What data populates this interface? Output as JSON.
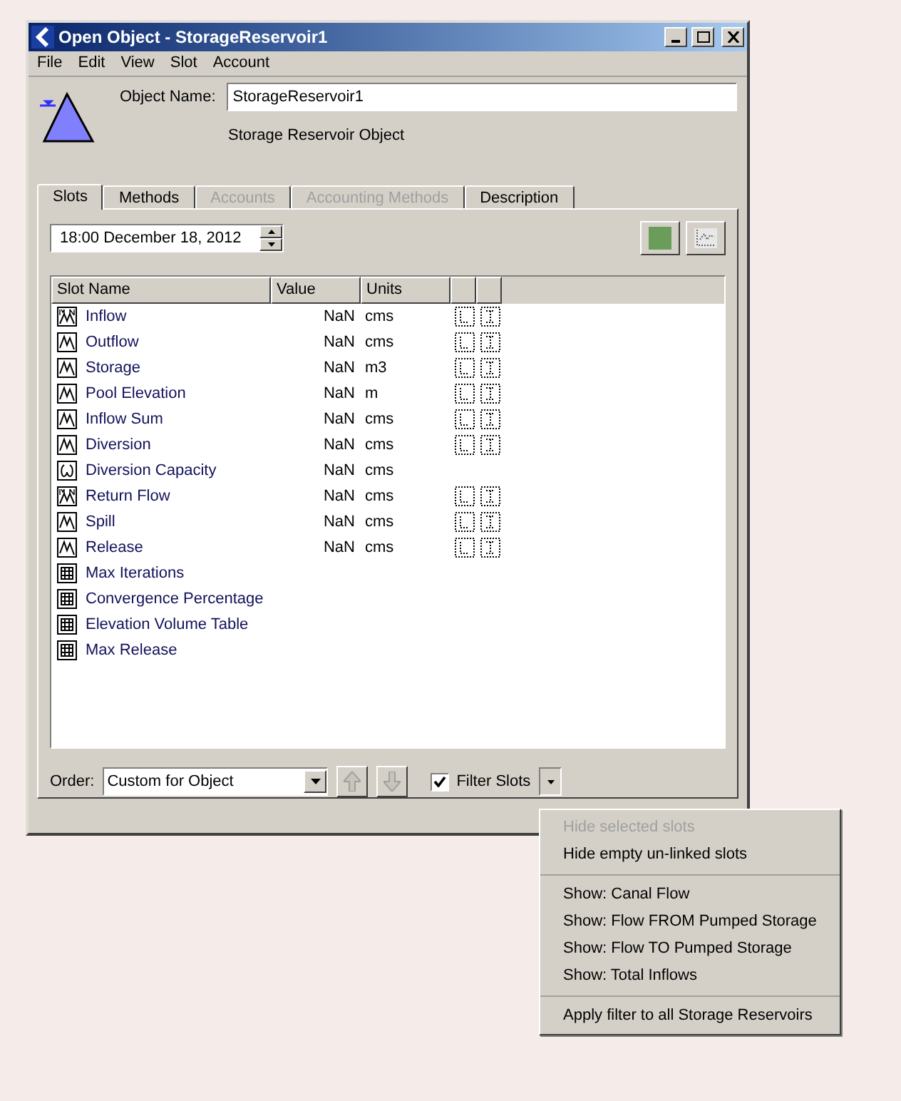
{
  "window": {
    "title": "Open Object - StorageReservoir1"
  },
  "menu_bar": [
    "File",
    "Edit",
    "View",
    "Slot",
    "Account"
  ],
  "object_name": {
    "label": "Object Name:",
    "value": "StorageReservoir1"
  },
  "object_type": "Storage Reservoir Object",
  "tabs": [
    {
      "label": "Slots",
      "selected": true,
      "disabled": false
    },
    {
      "label": "Methods",
      "selected": false,
      "disabled": false
    },
    {
      "label": "Accounts",
      "selected": false,
      "disabled": true
    },
    {
      "label": "Accounting Methods",
      "selected": false,
      "disabled": true
    },
    {
      "label": "Description",
      "selected": false,
      "disabled": false
    }
  ],
  "timestep": "18:00 December 18, 2012",
  "table": {
    "columns": [
      "Slot Name",
      "Value",
      "Units"
    ],
    "rows": [
      {
        "kind": "multi_series",
        "name": "Inflow",
        "value": "NaN",
        "units": "cms",
        "flags": true
      },
      {
        "kind": "series",
        "name": "Outflow",
        "value": "NaN",
        "units": "cms",
        "flags": true
      },
      {
        "kind": "series",
        "name": "Storage",
        "value": "NaN",
        "units": "m3",
        "flags": true
      },
      {
        "kind": "series",
        "name": "Pool Elevation",
        "value": "NaN",
        "units": "m",
        "flags": true
      },
      {
        "kind": "series",
        "name": "Inflow Sum",
        "value": "NaN",
        "units": "cms",
        "flags": true
      },
      {
        "kind": "series",
        "name": "Diversion",
        "value": "NaN",
        "units": "cms",
        "flags": true
      },
      {
        "kind": "scalar",
        "name": "Diversion Capacity",
        "value": "NaN",
        "units": "cms",
        "flags": false
      },
      {
        "kind": "multi_series",
        "name": "Return Flow",
        "value": "NaN",
        "units": "cms",
        "flags": true
      },
      {
        "kind": "series",
        "name": "Spill",
        "value": "NaN",
        "units": "cms",
        "flags": true
      },
      {
        "kind": "series",
        "name": "Release",
        "value": "NaN",
        "units": "cms",
        "flags": true
      },
      {
        "kind": "table",
        "name": "Max Iterations",
        "flags": false
      },
      {
        "kind": "table",
        "name": "Convergence Percentage",
        "flags": false
      },
      {
        "kind": "table",
        "name": "Elevation Volume Table",
        "flags": false
      },
      {
        "kind": "table",
        "name": "Max Release",
        "flags": false
      }
    ]
  },
  "order": {
    "label": "Order:",
    "value": "Custom for Object"
  },
  "filter_slots": {
    "label": "Filter Slots",
    "checked": true
  },
  "filter_menu": [
    [
      {
        "label": "Hide selected slots",
        "disabled": true
      },
      {
        "label": "Hide empty un-linked slots",
        "disabled": false
      }
    ],
    [
      {
        "label": "Show: Canal Flow",
        "disabled": false
      },
      {
        "label": "Show: Flow FROM Pumped Storage",
        "disabled": false
      },
      {
        "label": "Show: Flow TO Pumped Storage",
        "disabled": false
      },
      {
        "label": "Show: Total Inflows",
        "disabled": false
      }
    ],
    [
      {
        "label": "Apply filter to all Storage Reservoirs",
        "disabled": false
      }
    ]
  ]
}
